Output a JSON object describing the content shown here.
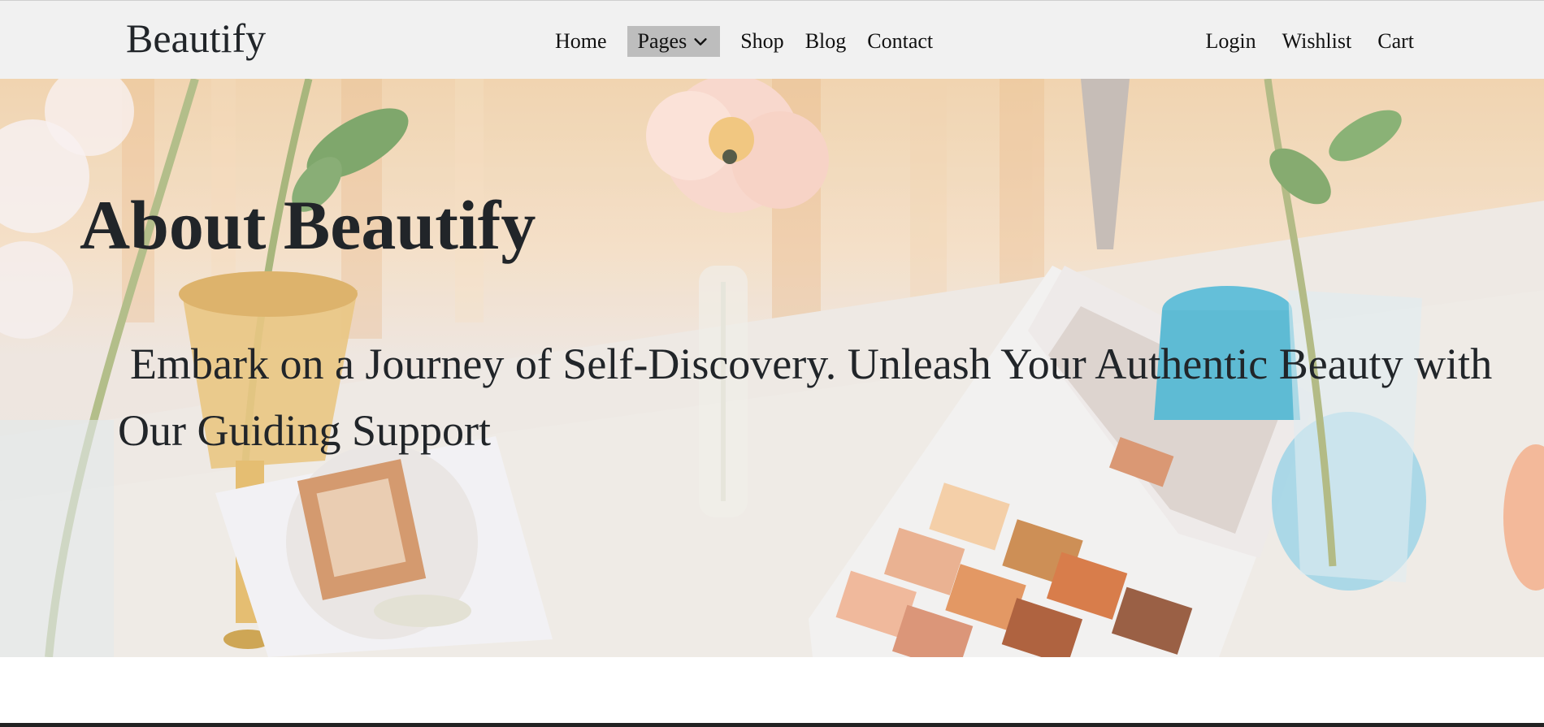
{
  "brand": {
    "name": "Beautify"
  },
  "nav": {
    "center": [
      {
        "label": "Home"
      },
      {
        "label": "Pages",
        "active": true,
        "icon": "chevron-down-icon"
      },
      {
        "label": "Shop"
      },
      {
        "label": "Blog"
      },
      {
        "label": "Contact"
      }
    ],
    "right": [
      {
        "label": "Login"
      },
      {
        "label": "Wishlist"
      },
      {
        "label": "Cart"
      }
    ]
  },
  "hero": {
    "title": "About Beautify",
    "subtitle": "Embark on a Journey of Self-Discovery. Unleash Your Authentic Beauty with Our Guiding Support"
  },
  "colors": {
    "navbar_bg": "#f1f1f1",
    "active_nav_bg": "#bdbdbd",
    "text": "#212529"
  }
}
